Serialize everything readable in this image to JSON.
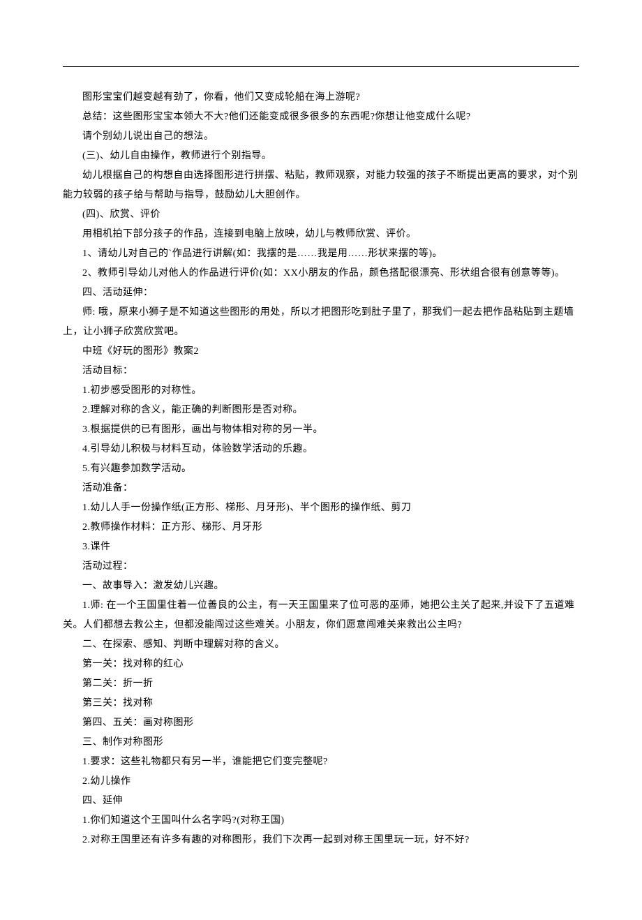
{
  "lines": [
    "图形宝宝们越变越有劲了，你看，他们又变成轮船在海上游呢?",
    "总结：这些图形宝宝本领大不大?他们还能变成很多很多的东西呢?你想让他变成什么呢?",
    "请个别幼儿说出自己的想法。",
    "(三)、幼儿自由操作，教师进行个别指导。",
    "幼儿根据自己的构想自由选择图形进行拼摆、粘贴，教师观察，对能力较强的孩子不断提出更高的要求，对个别能力较弱的孩子给与帮助与指导，鼓励幼儿大胆创作。",
    "(四)、欣赏、评价",
    "用相机拍下部分孩子的作品，连接到电脑上放映，幼儿与教师欣赏、评价。",
    "1、请幼儿对自己的`作品进行讲解(如：我摆的是……我是用……形状来摆的等)。",
    "2、教师引导幼儿对他人的作品进行评价(如：XX小朋友的作品，颜色搭配很漂亮、形状组合很有创意等等)。",
    "四、活动延伸：",
    "师: 哦，原来小狮子是不知道这些图形的用处，所以才把图形吃到肚子里了，那我们一起去把作品粘贴到主题墙上，让小狮子欣赏欣赏吧。",
    "中班《好玩的图形》教案2",
    "活动目标：",
    "1.初步感受图形的对称性。",
    "2.理解对称的含义，能正确的判断图形是否对称。",
    "3.根据提供的已有图形，画出与物体相对称的另一半。",
    "4.引导幼儿积极与材料互动，体验数学活动的乐趣。",
    "5.有兴趣参加数学活动。",
    "活动准备：",
    "1.幼儿人手一份操作纸(正方形、梯形、月牙形)、半个图形的操作纸、剪刀",
    "2.教师操作材料：正方形、梯形、月牙形",
    "3.课件",
    "活动过程：",
    "一、故事导入：激发幼儿兴趣。",
    "1.师: 在一个王国里住着一位善良的公主，有一天王国里来了位可恶的巫师，她把公主关了起来,并设下了五道难关。人们都想去救公主，但都没能闯过这些难关。小朋友，你们愿意闯难关来救出公主吗?",
    "二、在探索、感知、判断中理解对称的含义。",
    "第一关：找对称的红心",
    "第二关：折一折",
    "第三关：找对称",
    "第四、五关：画对称图形",
    "三、制作对称图形",
    "1.要求：这些礼物都只有另一半，谁能把它们变完整呢?",
    "2.幼儿操作",
    "四、延伸",
    "1.你们知道这个王国叫什么名字吗?(对称王国)",
    "2.对称王国里还有许多有趣的对称图形，我们下次再一起到对称王国里玩一玩，好不好?"
  ]
}
